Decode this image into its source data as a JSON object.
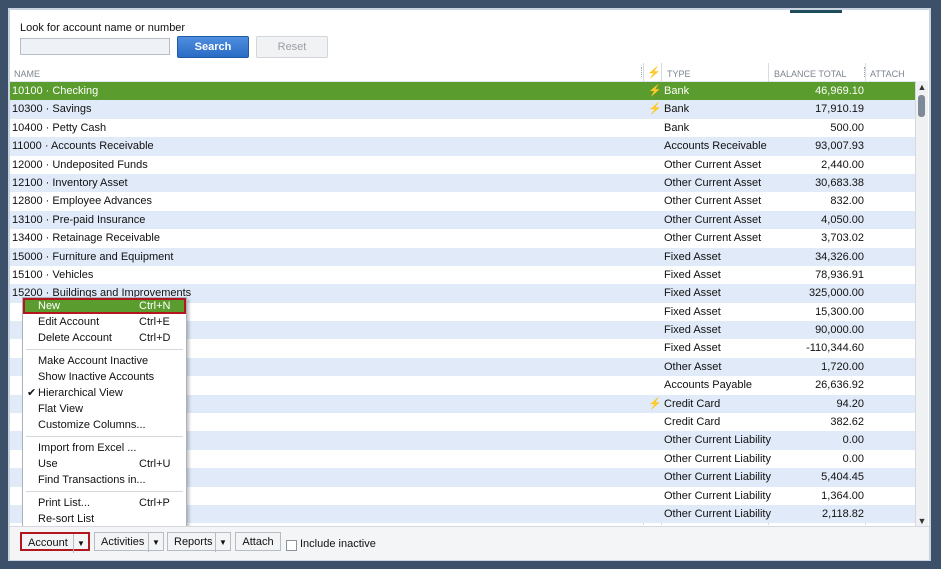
{
  "search": {
    "label": "Look for account name or number",
    "value": "",
    "search_button": "Search",
    "reset_button": "Reset"
  },
  "columns": {
    "name": "NAME",
    "bolt": "⚡",
    "type": "TYPE",
    "balance": "BALANCE TOTAL",
    "attach": "ATTACH"
  },
  "accounts": [
    {
      "name": "10100 · Checking",
      "bolt": "⚡",
      "type": "Bank",
      "balance": "46,969.10",
      "selected": true
    },
    {
      "name": "10300 · Savings",
      "bolt": "⚡",
      "type": "Bank",
      "balance": "17,910.19"
    },
    {
      "name": "10400 · Petty Cash",
      "bolt": "",
      "type": "Bank",
      "balance": "500.00"
    },
    {
      "name": "11000 · Accounts Receivable",
      "bolt": "",
      "type": "Accounts Receivable",
      "balance": "93,007.93"
    },
    {
      "name": "12000 · Undeposited Funds",
      "bolt": "",
      "type": "Other Current Asset",
      "balance": "2,440.00"
    },
    {
      "name": "12100 · Inventory Asset",
      "bolt": "",
      "type": "Other Current Asset",
      "balance": "30,683.38"
    },
    {
      "name": "12800 · Employee Advances",
      "bolt": "",
      "type": "Other Current Asset",
      "balance": "832.00"
    },
    {
      "name": "13100 · Pre-paid Insurance",
      "bolt": "",
      "type": "Other Current Asset",
      "balance": "4,050.00"
    },
    {
      "name": "13400 · Retainage Receivable",
      "bolt": "",
      "type": "Other Current Asset",
      "balance": "3,703.02"
    },
    {
      "name": "15000 · Furniture and Equipment",
      "bolt": "",
      "type": "Fixed Asset",
      "balance": "34,326.00"
    },
    {
      "name": "15100 · Vehicles",
      "bolt": "",
      "type": "Fixed Asset",
      "balance": "78,936.91"
    },
    {
      "name": "15200 · Buildings and Improvements",
      "bolt": "",
      "type": "Fixed Asset",
      "balance": "325,000.00"
    },
    {
      "name": "",
      "bolt": "",
      "type": "Fixed Asset",
      "balance": "15,300.00"
    },
    {
      "name": "",
      "bolt": "",
      "type": "Fixed Asset",
      "balance": "90,000.00"
    },
    {
      "name": "",
      "bolt": "",
      "type": "Fixed Asset",
      "balance": "-110,344.60"
    },
    {
      "name": "",
      "bolt": "",
      "type": "Other Asset",
      "balance": "1,720.00"
    },
    {
      "name": "",
      "bolt": "",
      "type": "Accounts Payable",
      "balance": "26,636.92"
    },
    {
      "name": "",
      "bolt": "⚡",
      "type": "Credit Card",
      "balance": "94.20"
    },
    {
      "name": "",
      "bolt": "",
      "type": "Credit Card",
      "balance": "382.62"
    },
    {
      "name": "",
      "bolt": "",
      "type": "Other Current Liability",
      "balance": "0.00"
    },
    {
      "name": "",
      "bolt": "",
      "type": "Other Current Liability",
      "balance": "0.00"
    },
    {
      "name": "",
      "bolt": "",
      "type": "Other Current Liability",
      "balance": "5,404.45"
    },
    {
      "name": "",
      "bolt": "",
      "type": "Other Current Liability",
      "balance": "1,364.00"
    },
    {
      "name": "",
      "bolt": "",
      "type": "Other Current Liability",
      "balance": "2,118.82"
    }
  ],
  "menu": [
    {
      "label": "New",
      "shortcut": "Ctrl+N",
      "highlight": true
    },
    {
      "label": "Edit Account",
      "shortcut": "Ctrl+E"
    },
    {
      "label": "Delete Account",
      "shortcut": "Ctrl+D"
    },
    {
      "separator": true
    },
    {
      "label": "Make Account Inactive",
      "shortcut": ""
    },
    {
      "label": "Show Inactive Accounts",
      "shortcut": ""
    },
    {
      "label": "Hierarchical View",
      "shortcut": "",
      "checked": true
    },
    {
      "label": "Flat View",
      "shortcut": ""
    },
    {
      "label": "Customize Columns...",
      "shortcut": ""
    },
    {
      "separator": true
    },
    {
      "label": "Import from Excel ...",
      "shortcut": ""
    },
    {
      "label": "Use",
      "shortcut": "Ctrl+U"
    },
    {
      "label": "Find Transactions in...",
      "shortcut": ""
    },
    {
      "separator": true
    },
    {
      "label": "Print List...",
      "shortcut": "Ctrl+P"
    },
    {
      "label": "Re-sort List",
      "shortcut": ""
    }
  ],
  "bottom": {
    "account": "Account",
    "activities": "Activities",
    "reports": "Reports",
    "attach": "Attach",
    "include_inactive": "Include inactive",
    "include_inactive_checked": false
  }
}
